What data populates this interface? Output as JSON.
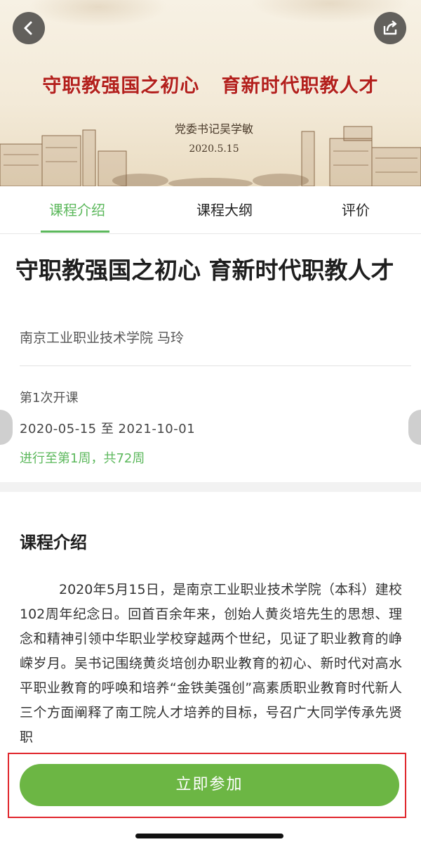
{
  "banner": {
    "title": "守职教强国之初心   育新时代职教人才",
    "subtitle": "党委书记吴学敏",
    "date": "2020.5.15"
  },
  "tabs": [
    {
      "label": "课程介绍",
      "active": true
    },
    {
      "label": "课程大纲",
      "active": false
    },
    {
      "label": "评价",
      "active": false
    }
  ],
  "course": {
    "title": "守职教强国之初心  育新时代职教人才",
    "org_teacher": "南京工业职业技术学院 马玲",
    "run_label": "第1次开课",
    "date_range": "2020-05-15 至 2021-10-01",
    "progress": "进行至第1周，共72周"
  },
  "intro": {
    "heading": "课程介绍",
    "body": "2020年5月15日，是南京工业职业技术学院（本科）建校102周年纪念日。回首百余年来，创始人黄炎培先生的思想、理念和精神引领中华职业学校穿越两个世纪，见证了职业教育的峥嵘岁月。吴书记围绕黄炎培创办职业教育的初心、新时代对高水平职业教育的呼唤和培养“金铁美强创”高素质职业教育时代新人三个方面阐释了南工院人才培养的目标，号召广大同学传承先贤职"
  },
  "actions": {
    "join_label": "立即参加"
  },
  "colors": {
    "accent_green": "#5cb85c",
    "button_green": "#6cb644",
    "banner_red": "#b3201c",
    "highlight_red": "#e0262c"
  },
  "icons": {
    "back": "chevron-left-icon",
    "share": "share-icon"
  }
}
